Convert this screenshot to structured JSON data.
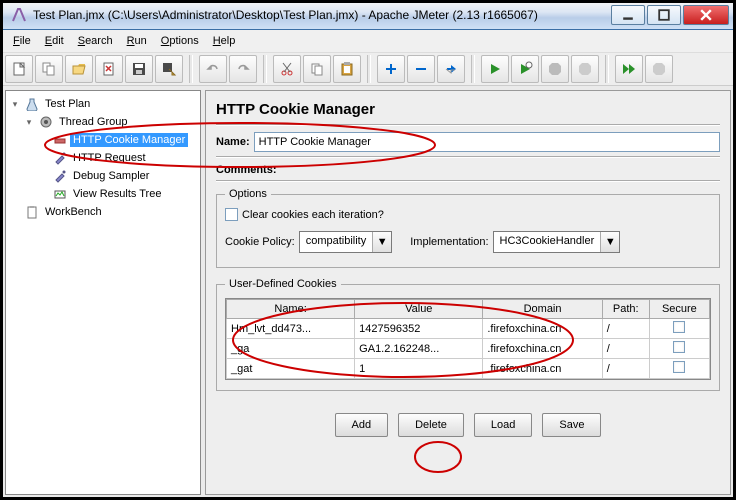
{
  "window": {
    "title": "Test Plan.jmx (C:\\Users\\Administrator\\Desktop\\Test Plan.jmx) - Apache JMeter (2.13 r1665067)"
  },
  "menu": {
    "file": "File",
    "edit": "Edit",
    "search": "Search",
    "run": "Run",
    "options": "Options",
    "help": "Help"
  },
  "tree": {
    "testplan": "Test Plan",
    "threadgroup": "Thread Group",
    "cookiemanager": "HTTP Cookie Manager",
    "httprequest": "HTTP Request",
    "debugsampler": "Debug Sampler",
    "viewresults": "View Results Tree",
    "workbench": "WorkBench"
  },
  "panel": {
    "heading": "HTTP Cookie Manager",
    "name_label": "Name:",
    "name_value": "HTTP Cookie Manager",
    "comments_label": "Comments:",
    "options_legend": "Options",
    "clear_label": "Clear cookies each iteration?",
    "policy_label": "Cookie Policy:",
    "policy_value": "compatibility",
    "impl_label": "Implementation:",
    "impl_value": "HC3CookieHandler",
    "cookies_legend": "User-Defined Cookies",
    "columns": {
      "name": "Name:",
      "value": "Value",
      "domain": "Domain",
      "path": "Path:",
      "secure": "Secure"
    },
    "rows": [
      {
        "name": "Hm_lvt_dd473...",
        "value": "1427596352",
        "domain": ".firefoxchina.cn",
        "path": "/"
      },
      {
        "name": "_ga",
        "value": "GA1.2.162248...",
        "domain": ".firefoxchina.cn",
        "path": "/"
      },
      {
        "name": "_gat",
        "value": "1",
        "domain": ".firefoxchina.cn",
        "path": "/"
      }
    ],
    "buttons": {
      "add": "Add",
      "delete": "Delete",
      "load": "Load",
      "save": "Save"
    }
  }
}
